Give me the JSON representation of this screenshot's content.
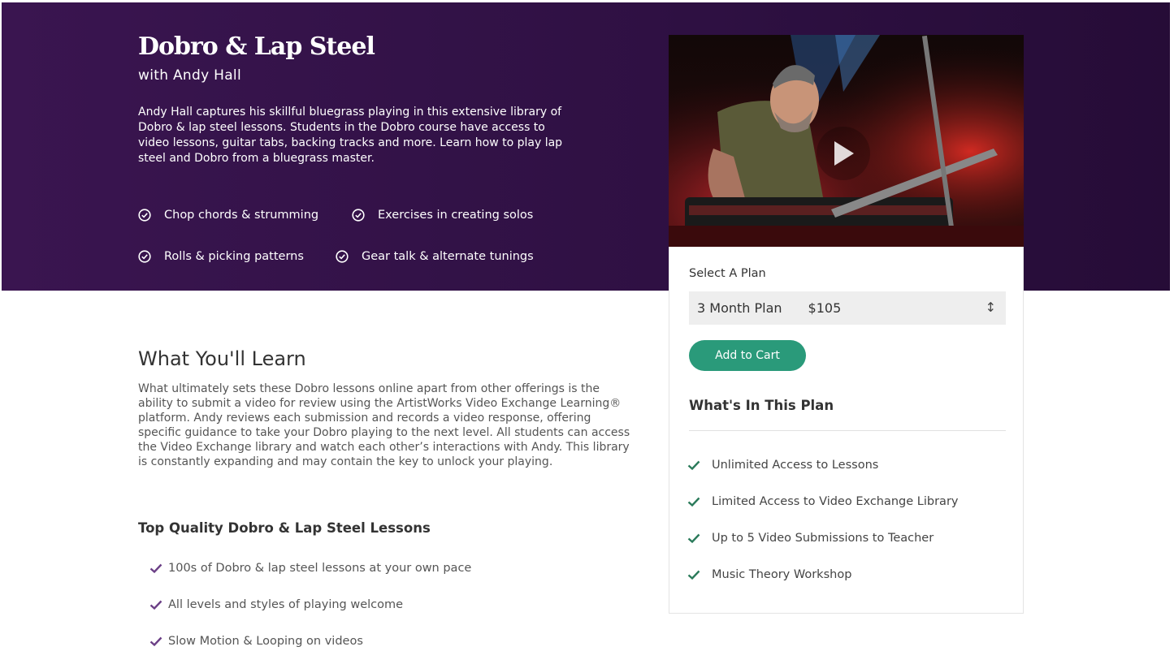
{
  "hero": {
    "title": "Dobro & Lap Steel",
    "subtitle": "with Andy Hall",
    "description": "Andy Hall captures his skillful bluegrass playing in this extensive library of Dobro & lap steel lessons. Students in the Dobro course have access to video lessons, guitar tabs, backing tracks and more. Learn how to play lap steel and Dobro from a bluegrass master.",
    "features": [
      "Chop chords & strumming",
      "Exercises in creating solos",
      "Rolls & picking patterns",
      "Gear talk & alternate tunings"
    ]
  },
  "plan": {
    "select_label": "Select A Plan",
    "selected_plan": "3 Month Plan",
    "selected_price": "$105",
    "add_to_cart": "Add to Cart",
    "heading": "What's In This Plan",
    "items": [
      "Unlimited Access to Lessons",
      "Limited Access to Video Exchange Library",
      "Up to 5 Video Submissions to Teacher",
      "Music Theory Workshop"
    ]
  },
  "learn": {
    "title": "What You'll Learn",
    "description": "What ultimately sets these Dobro lessons online apart from other offerings is the ability to submit a video for review using the ArtistWorks Video Exchange Learning® platform. Andy reviews each submission and records a video response, offering specific guidance to take your Dobro playing to the next level. All students can access the Video Exchange library and watch each other’s interactions with Andy. This library is constantly expanding and may contain the key to unlock your playing.",
    "quality_title": "Top Quality Dobro & Lap Steel Lessons",
    "quality_items": [
      "100s of Dobro & lap steel lessons at your own pace",
      "All levels and styles of playing welcome",
      "Slow Motion & Looping on videos"
    ]
  },
  "colors": {
    "hero_bg": "#2e1042",
    "accent_green": "#2a9a7a",
    "check_purple": "#6b3f86",
    "check_green": "#2a7a5a"
  },
  "icons": {
    "feature": "circle-check-icon",
    "plan_item": "checkmark-icon",
    "quality_item": "checkmark-icon",
    "video": "play-icon",
    "select": "up-down-arrows-icon"
  }
}
